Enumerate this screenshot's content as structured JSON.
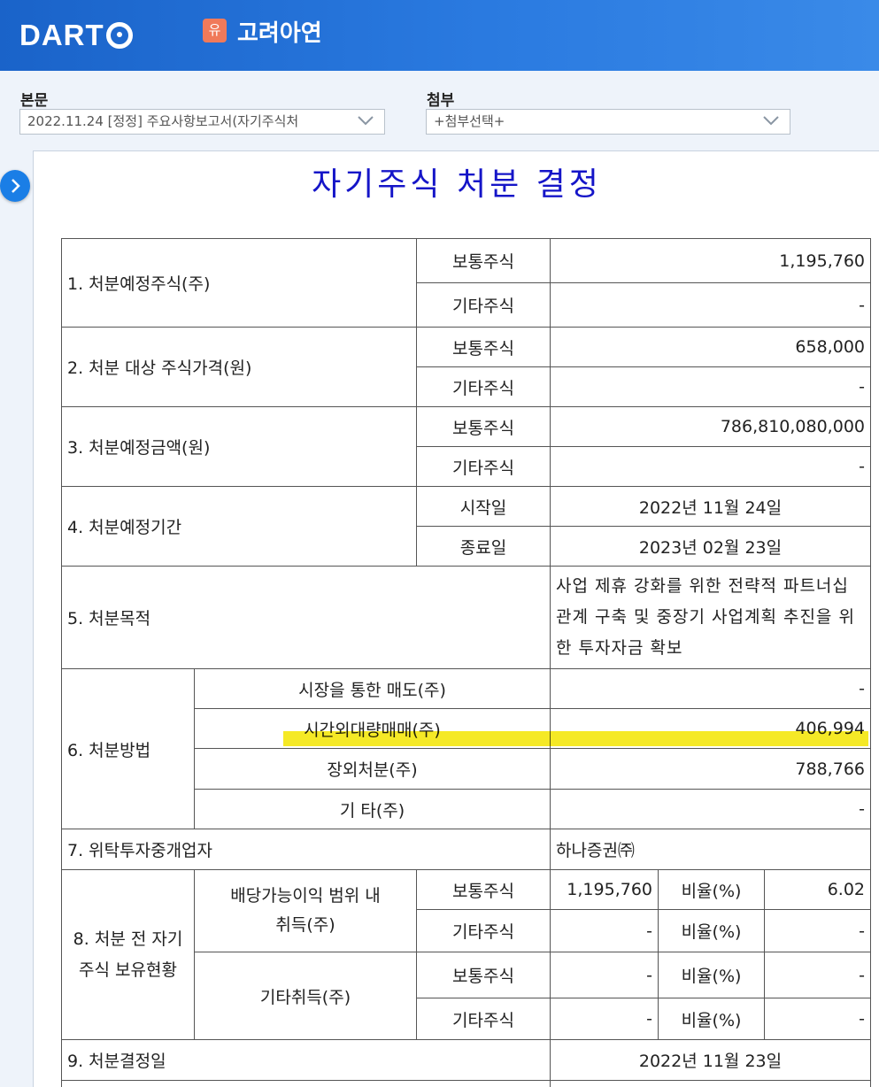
{
  "header": {
    "logo_text": "DART",
    "corp_badge": "유",
    "corp_name": "고려아연",
    "colors": {
      "header_bg": "#1a63c9",
      "badge": "#f07a5a",
      "title": "#1515c8",
      "highlight": "#f5e81a"
    }
  },
  "body_select": {
    "label": "본문",
    "value": "2022.11.24  [정정] 주요사항보고서(자기주식처"
  },
  "attach_select": {
    "label": "첨부",
    "value": "+첨부선택+"
  },
  "side_button_icon": "chevron-right-icon",
  "document": {
    "title": "자기주식 처분 결정",
    "r1": {
      "label": "1. 처분예정주식(주)",
      "common": "보통주식",
      "common_val": "1,195,760",
      "other": "기타주식",
      "other_val": "-"
    },
    "r2": {
      "label": "2. 처분 대상 주식가격(원)",
      "common": "보통주식",
      "common_val": "658,000",
      "other": "기타주식",
      "other_val": "-"
    },
    "r3": {
      "label": "3. 처분예정금액(원)",
      "common": "보통주식",
      "common_val": "786,810,080,000",
      "other": "기타주식",
      "other_val": "-"
    },
    "r4": {
      "label": "4. 처분예정기간",
      "start": "시작일",
      "start_val": "2022년 11월 24일",
      "end": "종료일",
      "end_val": "2023년 02월 23일"
    },
    "r5": {
      "label": "5. 처분목적",
      "value": "사업 제휴 강화를 위한 전략적 파트너십 관계 구축 및 중장기 사업계획 추진을 위한 투자자금 확보"
    },
    "r6": {
      "label": "6. 처분방법",
      "m1": "시장을 통한 매도(주)",
      "m1_val": "-",
      "m2": "시간외대량매매(주)",
      "m2_val": "406,994",
      "m3": "장외처분(주)",
      "m3_val": "788,766",
      "m4": "기 타(주)",
      "m4_val": "-"
    },
    "r7": {
      "label": "7. 위탁투자중개업자",
      "value": "하나증권㈜"
    },
    "r8": {
      "label": "8. 처분 전 자기주식 보유현황",
      "g1": "배당가능이익 범위 내 취득(주)",
      "g2": "기타취득(주)",
      "common": "보통주식",
      "other": "기타주식",
      "ratio": "비율(%)",
      "g1_common_val": "1,195,760",
      "g1_common_ratio": "6.02",
      "g1_other_val": "-",
      "g1_other_ratio": "-",
      "g2_common_val": "-",
      "g2_common_ratio": "-",
      "g2_other_val": "-",
      "g2_other_ratio": "-"
    },
    "r9": {
      "label": "9. 처분결정일",
      "value": "2022년 11월 23일"
    }
  }
}
